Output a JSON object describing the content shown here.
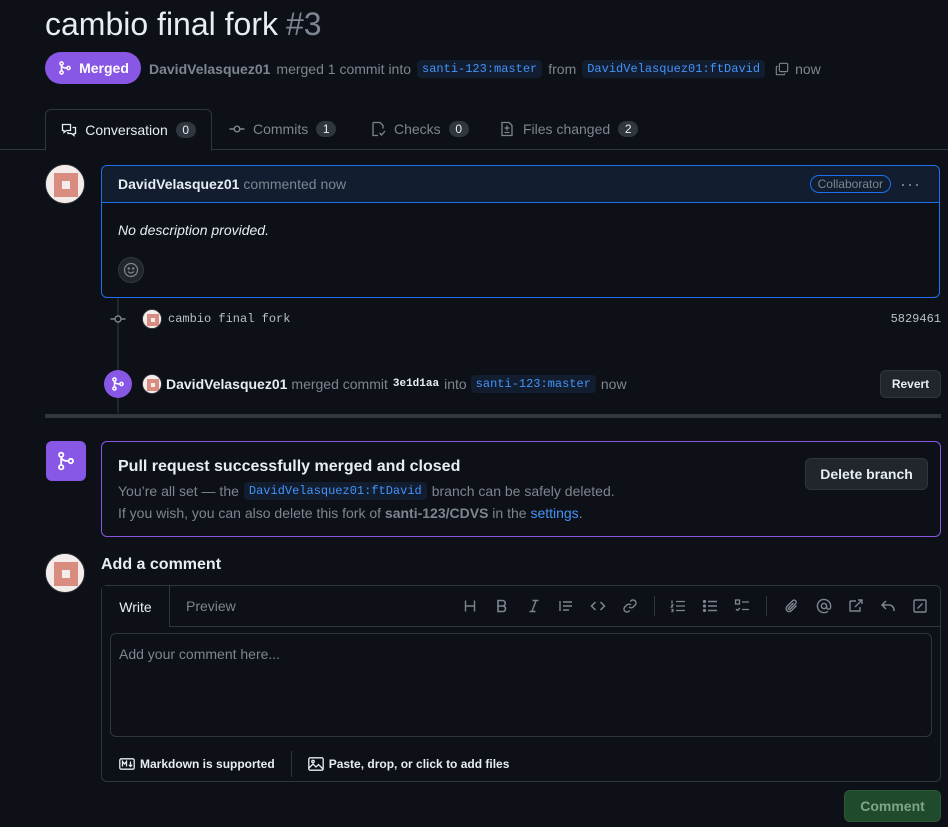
{
  "pr": {
    "title": "cambio final fork",
    "number": "#3",
    "status": "Merged",
    "author": "DavidVelasquez01",
    "merged_text": "merged 1 commit into",
    "base_branch": "santi-123:master",
    "from_text": "from",
    "head_branch": "DavidVelasquez01:ftDavid",
    "time": "now"
  },
  "tabs": [
    {
      "label": "Conversation",
      "count": "0"
    },
    {
      "label": "Commits",
      "count": "1"
    },
    {
      "label": "Checks",
      "count": "0"
    },
    {
      "label": "Files changed",
      "count": "2"
    }
  ],
  "comment": {
    "author": "DavidVelasquez01",
    "action": "commented now",
    "role": "Collaborator",
    "more": "···",
    "body": "No description provided."
  },
  "commit": {
    "message": "cambio final fork",
    "sha": "5829461"
  },
  "merge_event": {
    "author": "DavidVelasquez01",
    "text": "merged commit",
    "sha": "3e1d1aa",
    "into": "into",
    "branch": "santi-123:master",
    "time": "now",
    "revert_label": "Revert"
  },
  "merged_box": {
    "title": "Pull request successfully merged and closed",
    "line1_pre": "You’re all set — the",
    "line1_branch": "DavidVelasquez01:ftDavid",
    "line1_post": "branch can be safely deleted.",
    "line2_pre": "If you wish, you can also delete this fork of",
    "line2_repo": "santi-123/CDVS",
    "line2_mid": "in the",
    "line2_link": "settings",
    "line2_end": ".",
    "delete_label": "Delete branch"
  },
  "add_comment": {
    "title": "Add a comment",
    "write_tab": "Write",
    "preview_tab": "Preview",
    "placeholder": "Add your comment here...",
    "markdown_note": "Markdown is supported",
    "files_note": "Paste, drop, or click to add files",
    "submit_label": "Comment"
  },
  "colors": {
    "merged": "#8957e5",
    "accent": "#4493f8",
    "background": "#0d1117"
  }
}
